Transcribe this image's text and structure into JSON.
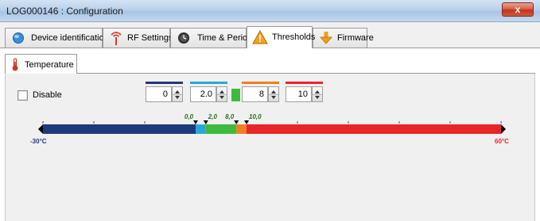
{
  "window": {
    "title": "LOG000146 : Configuration",
    "close_glyph": "x"
  },
  "tabs": [
    {
      "label": "Device identification",
      "icon": "device-globe-icon",
      "active": false
    },
    {
      "label": "RF Settings",
      "icon": "rf-antenna-icon",
      "active": false
    },
    {
      "label": "Time & Period",
      "icon": "clock-icon",
      "active": false
    },
    {
      "label": "Thresholds",
      "icon": "warning-triangle-icon",
      "active": true
    },
    {
      "label": "Firmware",
      "icon": "download-arrow-icon",
      "active": false
    }
  ],
  "subtab": {
    "label": "Temperature",
    "icon": "thermometer-icon"
  },
  "disable": {
    "label": "Disable",
    "checked": false
  },
  "thresholds": [
    {
      "value": "0",
      "color": "#1f3a7a"
    },
    {
      "value": "2.0",
      "color": "#2aa7d9"
    },
    {
      "value": "8",
      "color": "#f07f21"
    },
    {
      "value": "10",
      "color": "#e8262a"
    }
  ],
  "ok_swatch_color": "#3dbb3d",
  "scale": {
    "min_label": "-30°C",
    "max_label": "60°C",
    "min": -30,
    "max": 60,
    "markers": [
      {
        "value": 0,
        "label": "0,0"
      },
      {
        "value": 2,
        "label": "2,0"
      },
      {
        "value": 8,
        "label": "8,0"
      },
      {
        "value": 10,
        "label": "10,0"
      }
    ],
    "segments": [
      {
        "from": -30,
        "to": 0,
        "color": "#1f3a7a"
      },
      {
        "from": 0,
        "to": 2,
        "color": "#2aa7d9"
      },
      {
        "from": 2,
        "to": 8,
        "color": "#3dbb3d"
      },
      {
        "from": 8,
        "to": 10,
        "color": "#f07f21"
      },
      {
        "from": 10,
        "to": 60,
        "color": "#e8262a"
      }
    ],
    "min_label_color": "#1f3a7a",
    "max_label_color": "#e8262a"
  }
}
